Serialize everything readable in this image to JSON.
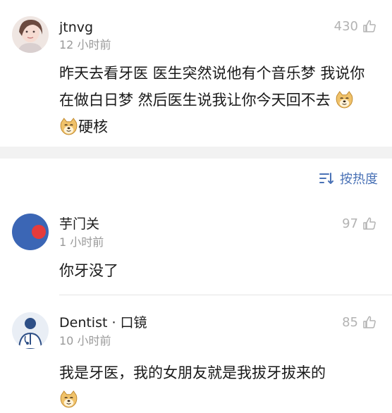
{
  "comments": [
    {
      "username": "jtnvg",
      "time": "12 小时前",
      "likes": "430",
      "text": "昨天去看牙医 医生突然说他有个音乐梦 我说你在做白日梦 然后医生说我让你今天回不去",
      "text_suffix": "硬核"
    }
  ],
  "sort_label": "按热度",
  "replies": [
    {
      "username": "芋门关",
      "time": "1 小时前",
      "likes": "97",
      "text": "你牙没了"
    },
    {
      "username": "Dentist · 口镜",
      "time": "10 小时前",
      "likes": "85",
      "text": "我是牙医，我的女朋友就是我拔牙拔来的"
    }
  ],
  "colors": {
    "accent": "#4a72b6",
    "muted": "#9a9a9a",
    "avatar_blue": "#3b66b5",
    "avatar_red": "#e53b3b"
  },
  "icons": [
    "thumbs-up-icon",
    "sort-icon",
    "doge-emoji",
    "avatar"
  ]
}
